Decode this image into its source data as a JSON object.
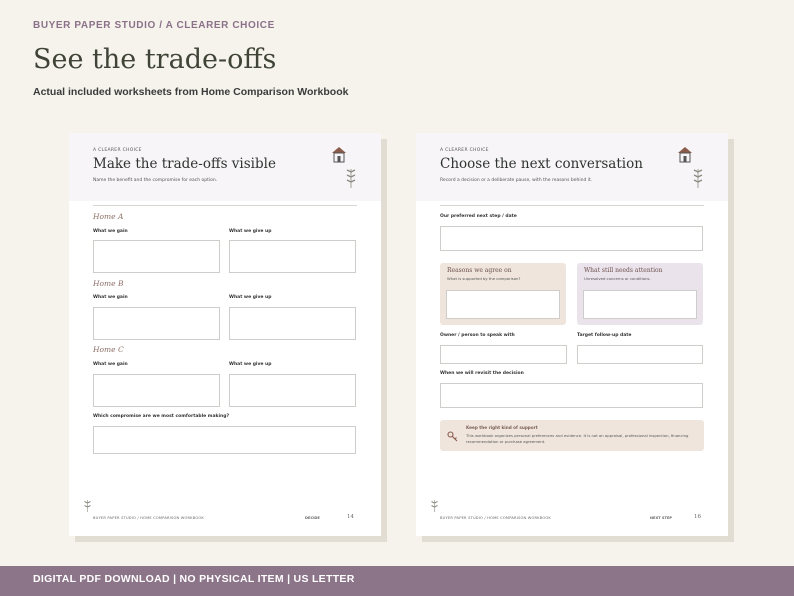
{
  "header": {
    "brand": "BUYER PAPER STUDIO  /  A CLEARER CHOICE",
    "headline": "See the trade-offs",
    "subhead": "Actual included worksheets from Home Comparison Workbook"
  },
  "footer_bar": {
    "text": "DIGITAL PDF DOWNLOAD   |   NO PHYSICAL ITEM   |   US LETTER"
  },
  "left_sheet": {
    "eyebrow": "A CLEARER CHOICE",
    "title": "Make the trade-offs visible",
    "description": "Name the benefit and the compromise for each option.",
    "homes": [
      {
        "name": "Home A",
        "gain_label": "What we gain",
        "give_label": "What we give up"
      },
      {
        "name": "Home B",
        "gain_label": "What we gain",
        "give_label": "What we give up"
      },
      {
        "name": "Home C",
        "gain_label": "What we gain",
        "give_label": "What we give up"
      }
    ],
    "question": "Which compromise are we most comfortable making?",
    "footer": {
      "left": "BUYER PAPER STUDIO  /  HOME COMPARISON WORKBOOK",
      "section": "DECIDE",
      "page": "14"
    }
  },
  "right_sheet": {
    "eyebrow": "A CLEARER CHOICE",
    "title": "Choose the next conversation",
    "description": "Record a decision or a deliberate pause, with the reasons behind it.",
    "next_step_label": "Our preferred next step / date",
    "agree_panel": {
      "title": "Reasons we agree on",
      "sub": "What is supported by the comparison?"
    },
    "open_panel": {
      "title": "What still needs attention",
      "sub": "Unresolved concerns or conditions."
    },
    "owner_label": "Owner / person to speak with",
    "target_label": "Target follow-up date",
    "revisit_label": "When we will revisit the decision",
    "support": {
      "title": "Keep the right kind of support",
      "text": "This workbook organizes personal preferences and evidence. It is not an appraisal, professional inspection, financing recommendation or purchase agreement."
    },
    "footer": {
      "left": "BUYER PAPER STUDIO  /  HOME COMPARISON WORKBOOK",
      "section": "NEXT STEP",
      "page": "16"
    }
  },
  "icons": {
    "house": "house-icon",
    "wheat": "wheat-icon",
    "key": "key-icon",
    "colors": {
      "accent": "#8d7589",
      "roof": "#8a5a4a",
      "wheat": "#8e8b82"
    }
  }
}
